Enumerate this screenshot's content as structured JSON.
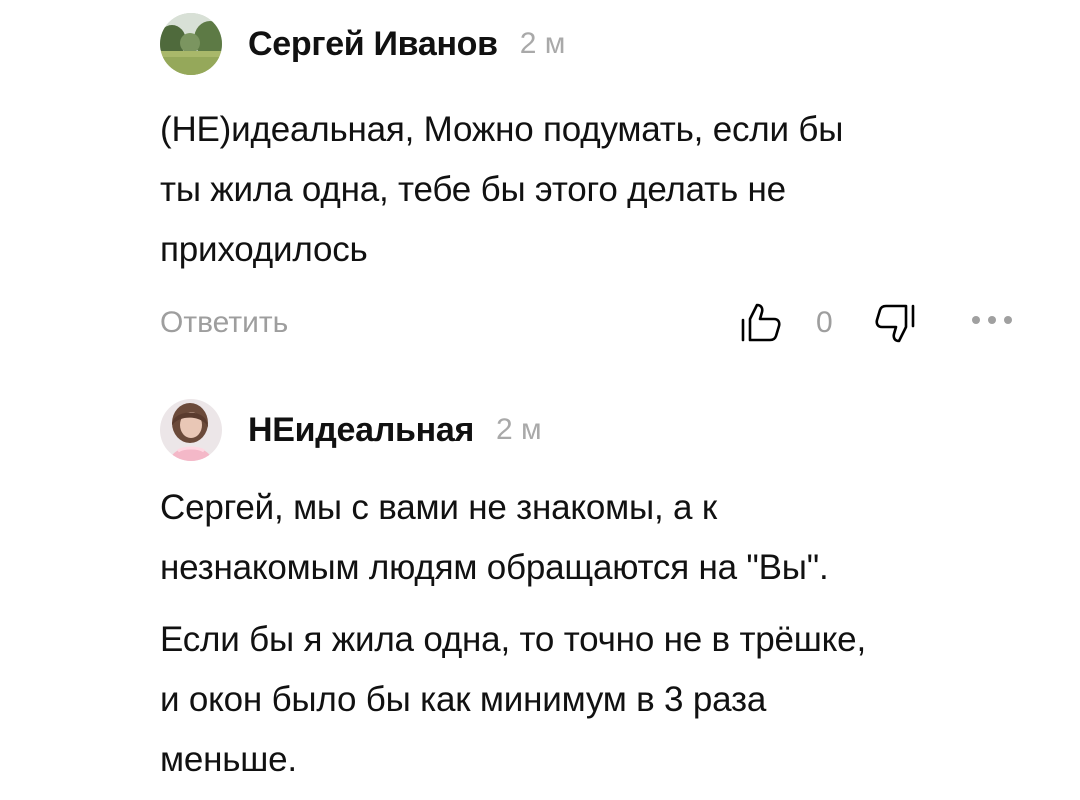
{
  "comments": [
    {
      "author": "Сергей Иванов",
      "time": "2 м",
      "avatar_icon": "landscape-avatar",
      "text_lines": [
        "(НЕ)идеальная, Можно подумать, если бы",
        "ты жила одна, тебе бы этого делать не",
        "приходилось"
      ],
      "actions": {
        "reply_label": "Ответить",
        "like_icon": "thumbs-up-icon",
        "like_count": "0",
        "dislike_icon": "thumbs-down-icon",
        "more_icon": "more-icon"
      }
    },
    {
      "author": "НЕидеальная",
      "time": "2 м",
      "avatar_icon": "portrait-avatar",
      "paragraphs": [
        [
          "Сергей, мы с вами не знакомы, а к",
          "незнакомым людям обращаются на \"Вы\"."
        ],
        [
          "Если бы я жила одна, то точно не в трёшке,",
          "и окон было бы как минимум в 3 раза",
          "меньше."
        ]
      ]
    }
  ],
  "colors": {
    "text": "#111111",
    "muted": "#9e9e9e",
    "time": "#a9a9a9"
  }
}
